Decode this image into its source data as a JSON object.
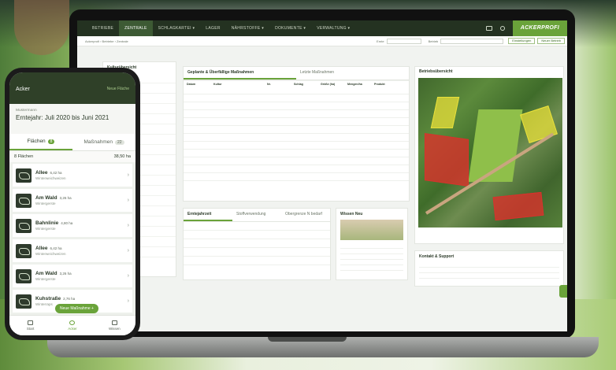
{
  "laptop": {
    "nav": {
      "items": [
        "BETRIEBE",
        "ZENTRALE",
        "SCHLAGKARTEI ▾",
        "LAGER",
        "NÄHRSTOFFE ▾",
        "DOKUMENTE ▾",
        "VERWALTUNG ▾"
      ],
      "active_index": 1,
      "logo": "ACKERPROFI"
    },
    "subbar": {
      "breadcrumb": "Ackerprofi  ›  Betriebe  ›  Zentrale",
      "label_a": "Ernte",
      "label_b": "Betrieb",
      "btn_a": "Einstellungen",
      "btn_b": "Neuer Betrieb"
    },
    "kultur_title": "Kulturübersicht",
    "measures": {
      "title": "Geplante & Überfällige Maßnahmen",
      "tab2": "Letzte Maßnahmen",
      "headers": [
        "Datum",
        "Kultur",
        "",
        "Nr.",
        "Schlag",
        "Größe (ha)",
        "Mengen/ha",
        "Produkt",
        ""
      ]
    },
    "yield_tabs": [
      "Erntejahrzeit",
      "Stoffverwendung",
      "Obergrenze N bedarf"
    ],
    "news_title": "Wissen Neu",
    "support_title": "Kontakt & Support",
    "map_title": "Betriebsübersicht"
  },
  "phone": {
    "app_title": "Acker",
    "new_field": "Neue Fläche",
    "master_label": "Mustermann",
    "harvest_year": "Erntejahr: Juli 2020 bis Juni 2021",
    "tab_fields": "Flächen",
    "tab_fields_count": "8",
    "tab_measures": "Maßnahmen",
    "tab_measures_count": "22",
    "count_label": "8 Flächen",
    "total_area": "38,50 ha",
    "fields": [
      {
        "name": "Allee",
        "area": "6,42 ha",
        "crop": "Winterweichweizen"
      },
      {
        "name": "Am Wald",
        "area": "3,26 ha",
        "crop": "Wintergerste"
      },
      {
        "name": "Bahnlinie",
        "area": "4,80 ha",
        "crop": "Wintergerste"
      },
      {
        "name": "Allee",
        "area": "6,42 ha",
        "crop": "Winterweichweizen"
      },
      {
        "name": "Am Wald",
        "area": "3,26 ha",
        "crop": "Wintergerste"
      },
      {
        "name": "Kuhstraße",
        "area": "2,76 ha",
        "crop": "Winterraps"
      }
    ],
    "fab": "Neue Maßnahme +",
    "nav": [
      "Start",
      "Acker",
      "Wissen"
    ],
    "nav_active": 1
  },
  "colors": {
    "brand": "#6aa33a",
    "nav_dark": "#243221",
    "field_red": "#d9322c",
    "field_yellow": "#e9e03a"
  }
}
